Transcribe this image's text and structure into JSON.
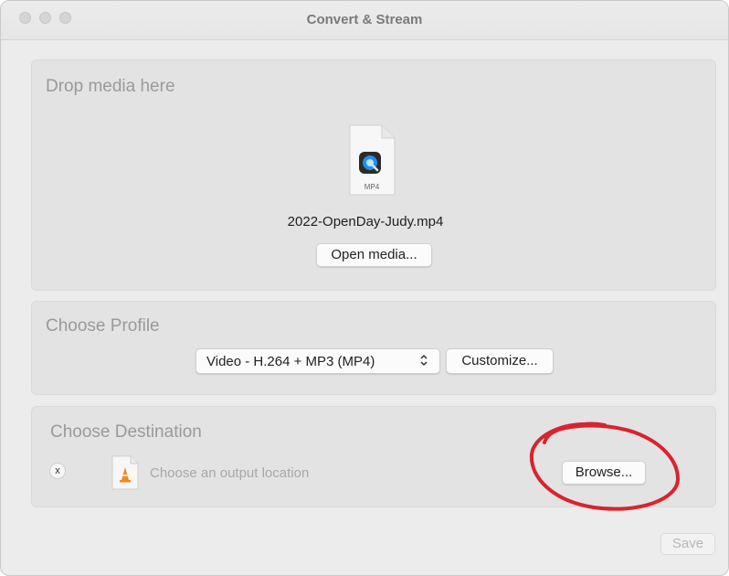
{
  "window": {
    "title": "Convert & Stream"
  },
  "drop": {
    "title": "Drop media here",
    "file_type": "MP4",
    "file_name": "2022-OpenDay-Judy.mp4",
    "open_button": "Open media..."
  },
  "profile": {
    "title": "Choose Profile",
    "selected": "Video - H.264 + MP3 (MP4)",
    "customize_button": "Customize..."
  },
  "destination": {
    "title": "Choose Destination",
    "clear_glyph": "x",
    "placeholder": "Choose an output location",
    "browse_button": "Browse..."
  },
  "footer": {
    "save_button": "Save"
  },
  "colors": {
    "annotation": "#d9232e",
    "panel": "#e3e3e3",
    "window": "#ececec"
  },
  "icons": [
    "quicktime-icon",
    "vlc-cone-icon",
    "chevron-updown-icon"
  ]
}
